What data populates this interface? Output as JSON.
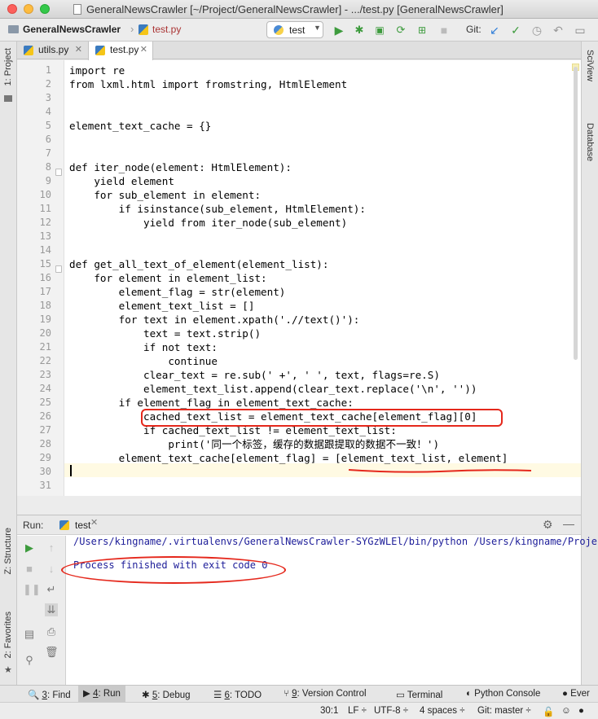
{
  "window": {
    "title": "GeneralNewsCrawler [~/Project/GeneralNewsCrawler] - .../test.py [GeneralNewsCrawler]"
  },
  "navbar": {
    "project": "GeneralNewsCrawler",
    "file": "test.py",
    "run_config": "test",
    "git_label": "Git:"
  },
  "side": {
    "left_top": "1: Project",
    "left_mid": "Z: Structure",
    "left_bot": "2: Favorites",
    "right_top": "SciView",
    "right_bot": "Database"
  },
  "tabs": [
    {
      "label": "utils.py"
    },
    {
      "label": "test.py"
    }
  ],
  "editor": {
    "line_numbers": [
      "1",
      "2",
      "3",
      "4",
      "5",
      "6",
      "7",
      "8",
      "9",
      "10",
      "11",
      "12",
      "13",
      "14",
      "15",
      "16",
      "17",
      "18",
      "19",
      "20",
      "21",
      "22",
      "23",
      "24",
      "25",
      "26",
      "27",
      "28",
      "29",
      "30",
      "31"
    ],
    "lines": [
      "import re",
      "from lxml.html import fromstring, HtmlElement",
      "",
      "",
      "element_text_cache = {}",
      "",
      "",
      "def iter_node(element: HtmlElement):",
      "    yield element",
      "    for sub_element in element:",
      "        if isinstance(sub_element, HtmlElement):",
      "            yield from iter_node(sub_element)",
      "",
      "",
      "def get_all_text_of_element(element_list):",
      "    for element in element_list:",
      "        element_flag = str(element)",
      "        element_text_list = []",
      "        for text in element.xpath('.//text()'):",
      "            text = text.strip()",
      "            if not text:",
      "                continue",
      "            clear_text = re.sub(' +', ' ', text, flags=re.S)",
      "            element_text_list.append(clear_text.replace('\\n', ''))",
      "        if element_flag in element_text_cache:",
      "            cached_text_list = element_text_cache[element_flag][0]",
      "            if cached_text_list != element_text_list:",
      "                print('同一个标签，缓存的数据跟提取的数据不一致！')",
      "        element_text_cache[element_flag] = [element_text_list, element]",
      "",
      ""
    ]
  },
  "run": {
    "label": "Run:",
    "tab": "test",
    "command": "/Users/kingname/.virtualenvs/GeneralNewsCrawler-SYGzWLEl/bin/python /Users/kingname/Proje",
    "result": "Process finished with exit code 0"
  },
  "toolwindows": [
    {
      "num": "3",
      "label": ": Find"
    },
    {
      "num": "4",
      "label": ": Run"
    },
    {
      "num": "5",
      "label": ": Debug"
    },
    {
      "num": "6",
      "label": ": TODO"
    },
    {
      "num": "9",
      "label": ": Version Control"
    },
    {
      "num": "",
      "label": "Terminal"
    },
    {
      "num": "",
      "label": "Python Console"
    },
    {
      "num": "",
      "label": "Ever"
    }
  ],
  "status": {
    "position": "30:1",
    "line_sep": "LF ÷",
    "encoding": "UTF-8 ÷",
    "indent": "4 spaces ÷",
    "git": "Git: master ÷"
  },
  "colors": {
    "keyword": "#000080",
    "annotation": "#e5281c",
    "output": "#1d1d99"
  }
}
